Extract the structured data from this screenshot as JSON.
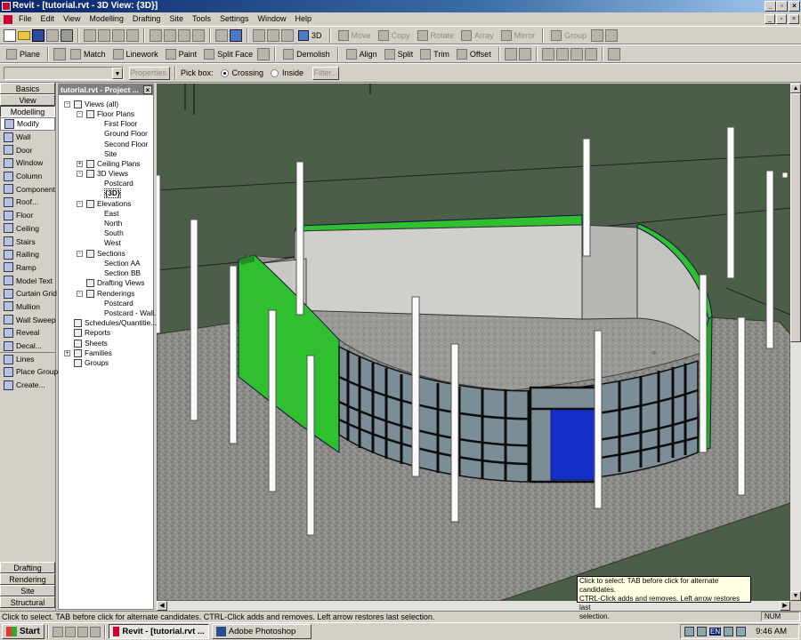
{
  "window": {
    "title": "Revit - [tutorial.rvt - 3D View: {3D}]"
  },
  "menu": [
    "File",
    "Edit",
    "View",
    "Modelling",
    "Drafting",
    "Site",
    "Tools",
    "Settings",
    "Window",
    "Help"
  ],
  "toolbar1": {
    "three_d_label": "3D",
    "move": "Move",
    "copy": "Copy",
    "rotate": "Rotate",
    "array": "Array",
    "mirror": "Mirror",
    "group": "Group"
  },
  "toolbar2": {
    "plane": "Plane",
    "match": "Match",
    "linework": "Linework",
    "paint": "Paint",
    "split_face": "Split Face",
    "demolish": "Demolish",
    "align": "Align",
    "split": "Split",
    "trim": "Trim",
    "offset": "Offset"
  },
  "optionsbar": {
    "type_value": "",
    "properties_button": "Properties...",
    "pickbox_label": "Pick box:",
    "crossing": "Crossing",
    "inside": "Inside",
    "filter_button": "Filter..."
  },
  "design_bar": {
    "top_tabs": [
      "Basics",
      "View",
      "Modelling"
    ],
    "tools": [
      "Modify",
      "Wall",
      "Door",
      "Window",
      "Column",
      "Component",
      "Roof...",
      "Floor",
      "Ceiling",
      "Stairs",
      "Railing",
      "Ramp",
      "Model Text",
      "Curtain Grid",
      "Mullion",
      "Wall Sweep",
      "Reveal",
      "Decal...",
      "Lines",
      "Place Group",
      "Create..."
    ],
    "bottom_tabs": [
      "Drafting",
      "Rendering",
      "Site",
      "Structural"
    ]
  },
  "project_browser": {
    "title": "tutorial.rvt - Project ...",
    "views_all": "Views (all)",
    "floor_plans": "Floor Plans",
    "fp_items": [
      "First Floor",
      "Ground Floor",
      "Second Floor",
      "Site"
    ],
    "ceiling_plans": "Ceiling Plans",
    "views_3d": "3D Views",
    "v3d_items": [
      "Postcard",
      "{3D}"
    ],
    "elevations": "Elevations",
    "el_items": [
      "East",
      "North",
      "South",
      "West"
    ],
    "sections": "Sections",
    "sec_items": [
      "Section AA",
      "Section BB"
    ],
    "drafting_views": "Drafting Views",
    "renderings": "Renderings",
    "ren_items": [
      "Postcard",
      "Postcard - Wall..."
    ],
    "schedules": "Schedules/Quantitie...",
    "reports": "Reports",
    "sheets": "Sheets",
    "families": "Families",
    "groups": "Groups"
  },
  "tooltip": {
    "line1": "Click to select. TAB before click for alternate candidates.",
    "line2": "CTRL-Click adds and removes. Left arrow restores last",
    "line3": "selection."
  },
  "status": {
    "text": "Click to select. TAB before click for alternate candidates. CTRL-Click adds and removes. Left arrow restores last selection.",
    "num": "NUM"
  },
  "taskbar": {
    "start": "Start",
    "task1": "Revit - [tutorial.rvt ...",
    "task2": "Adobe Photoshop",
    "lang": "EN",
    "time": "9:46 AM"
  },
  "colors": {
    "ground": "#4b5f48",
    "slab": "#8c8b88",
    "wall_green": "#2fbf2f",
    "glass": "#7b8d96",
    "door": "#1530c8"
  }
}
